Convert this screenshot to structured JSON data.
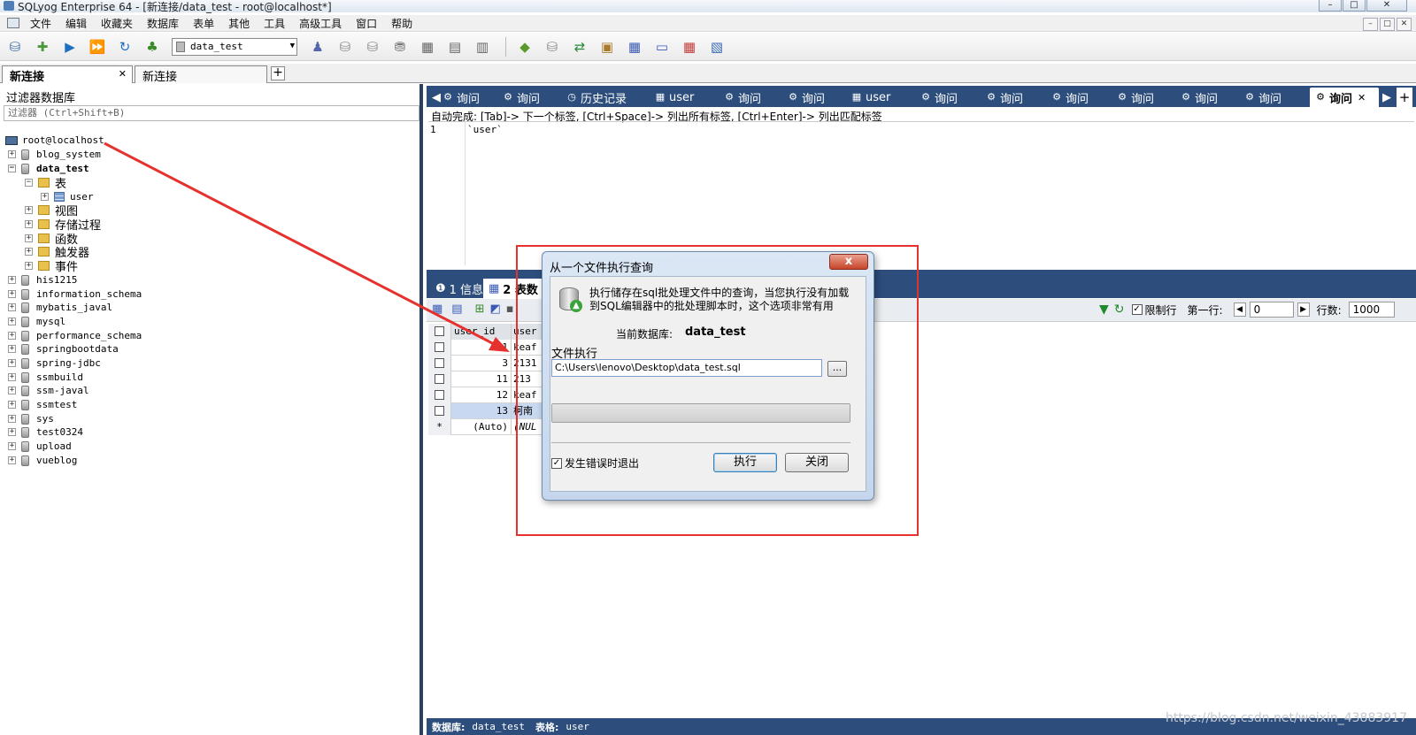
{
  "window": {
    "title": "SQLyog Enterprise 64 - [新连接/data_test - root@localhost*]",
    "controls": [
      "–",
      "□",
      "✕"
    ]
  },
  "menu": [
    "文件",
    "编辑",
    "收藏夹",
    "数据库",
    "表单",
    "其他",
    "工具",
    "高级工具",
    "窗口",
    "帮助"
  ],
  "toolbar": {
    "database_select": "data_test"
  },
  "connection_tabs": [
    {
      "label": "新连接",
      "close": "✕"
    },
    {
      "label": "新连接"
    }
  ],
  "add_tab": "+",
  "filter": {
    "header": "过滤器数据库",
    "placeholder": "过滤器 (Ctrl+Shift+B)"
  },
  "tree": {
    "root": "root@localhost",
    "databases_before": [
      "blog_system"
    ],
    "expanded_db": "data_test",
    "expanded_children": {
      "tables_folder": "表",
      "table": "user",
      "folders": [
        "视图",
        "存储过程",
        "函数",
        "触发器",
        "事件"
      ]
    },
    "databases_after": [
      "his1215",
      "information_schema",
      "mybatis_javal",
      "mysql",
      "performance_schema",
      "springbootdata",
      "spring-jdbc",
      "ssmbuild",
      "ssm-javal",
      "ssmtest",
      "sys",
      "test0324",
      "upload",
      "vueblog"
    ]
  },
  "query_tabs": [
    {
      "label": "询问",
      "icon": "query-icon"
    },
    {
      "label": "询问",
      "icon": "query-icon"
    },
    {
      "label": "历史记录",
      "icon": "history-icon"
    },
    {
      "label": "user",
      "icon": "table-icon"
    },
    {
      "label": "询问",
      "icon": "query-icon"
    },
    {
      "label": "询问",
      "icon": "query-icon"
    },
    {
      "label": "user",
      "icon": "table-icon"
    },
    {
      "label": "询问",
      "icon": "query-icon"
    },
    {
      "label": "询问",
      "icon": "query-icon"
    },
    {
      "label": "询问",
      "icon": "query-icon"
    },
    {
      "label": "询问",
      "icon": "query-icon"
    },
    {
      "label": "询问",
      "icon": "query-icon"
    },
    {
      "label": "询问",
      "icon": "query-icon"
    },
    {
      "label": "询问",
      "icon": "query-icon",
      "active": true,
      "close": "✕"
    }
  ],
  "editor": {
    "hint": "自动完成: [Tab]-> 下一个标签, [Ctrl+Space]-> 列出所有标签, [Ctrl+Enter]-> 列出匹配标签",
    "line_number": "1",
    "code": "`user`"
  },
  "result_tabs": [
    {
      "label": "1 信息"
    },
    {
      "label": "2 表数",
      "active": true
    }
  ],
  "result_toolbar": {
    "limit_label": "限制行",
    "first_row_label": "第一行:",
    "first_row_value": "0",
    "rows_label": "行数:",
    "rows_value": "1000"
  },
  "grid": {
    "columns": [
      "user_id",
      "user"
    ],
    "rows": [
      {
        "id": "1",
        "name": "keaf"
      },
      {
        "id": "3",
        "name": "2131"
      },
      {
        "id": "11",
        "name": "213"
      },
      {
        "id": "12",
        "name": "keaf"
      },
      {
        "id": "13",
        "name": "柯南"
      }
    ],
    "new_row": {
      "marker": "*",
      "id": "(Auto)",
      "name": "(NUL"
    }
  },
  "statusbar": {
    "db_label": "数据库:",
    "db_value": "data_test",
    "table_label": "表格:",
    "table_value": "user"
  },
  "watermark": "https://blog.csdn.net/weixin_43883917",
  "dialog": {
    "title": "从一个文件执行查询",
    "close": "x",
    "description_1": "执行储存在sql批处理文件中的查询，当您执行没有加载",
    "description_2": "到SQL编辑器中的批处理脚本时，这个选项非常有用",
    "current_db_label": "当前数据库:",
    "current_db_value": "data_test",
    "file_label": "文件执行",
    "file_path": "C:\\Users\\lenovo\\Desktop\\data_test.sql",
    "browse": "...",
    "exit_on_error": "发生错误时退出",
    "execute": "执行",
    "close_button": "关闭"
  },
  "colors": {
    "accent_blue": "#2d4e7d",
    "annotation_red": "#e6322e"
  }
}
